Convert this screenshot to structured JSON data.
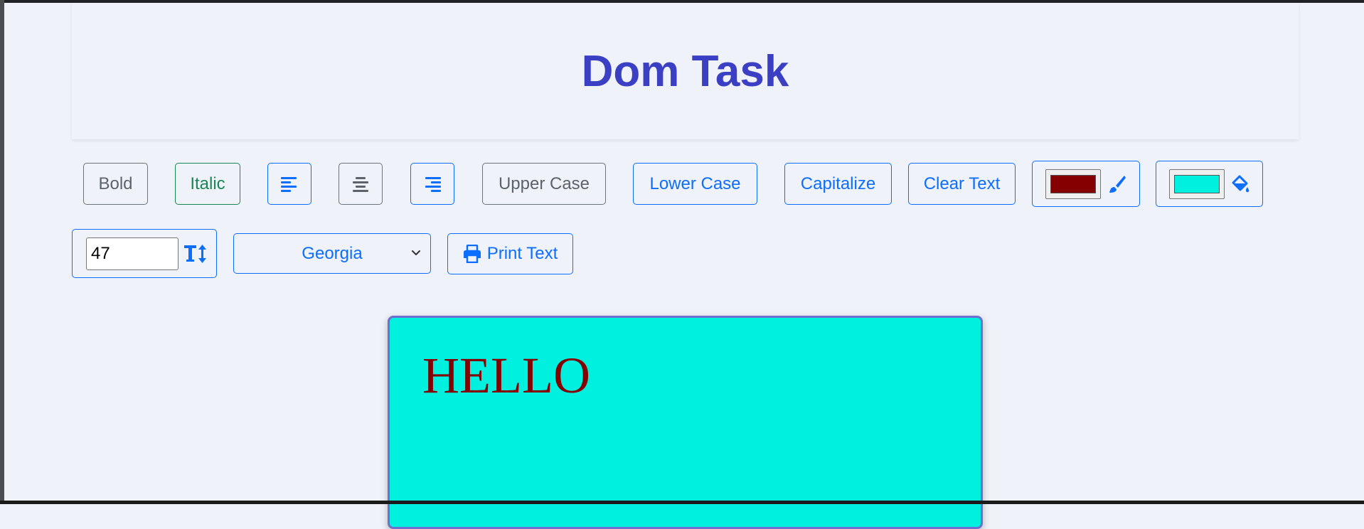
{
  "header": {
    "title": "Dom Task"
  },
  "toolbar": {
    "bold_label": "Bold",
    "italic_label": "Italic",
    "uppercase_label": "Upper Case",
    "lowercase_label": "Lower Case",
    "capitalize_label": "Capitalize",
    "clear_label": "Clear Text",
    "text_color": "#850000",
    "bg_color": "#00f0e0",
    "font_size_value": "47",
    "font_family_selected": "Georgia",
    "print_label": "Print Text"
  },
  "icons": {
    "align_left": "align-left-icon",
    "align_center": "align-center-icon",
    "align_right": "align-right-icon",
    "text_color": "paint-brush-icon",
    "bg_color": "fill-bucket-icon",
    "font_size": "text-height-icon",
    "print": "print-icon",
    "select": "chevron-down-icon"
  },
  "colors": {
    "primary": "#0d6efd",
    "secondary": "#6c757d",
    "success": "#198754",
    "title": "#3b3fc4",
    "page_bg": "#eff2f8"
  },
  "editor": {
    "text": "HELLO"
  }
}
